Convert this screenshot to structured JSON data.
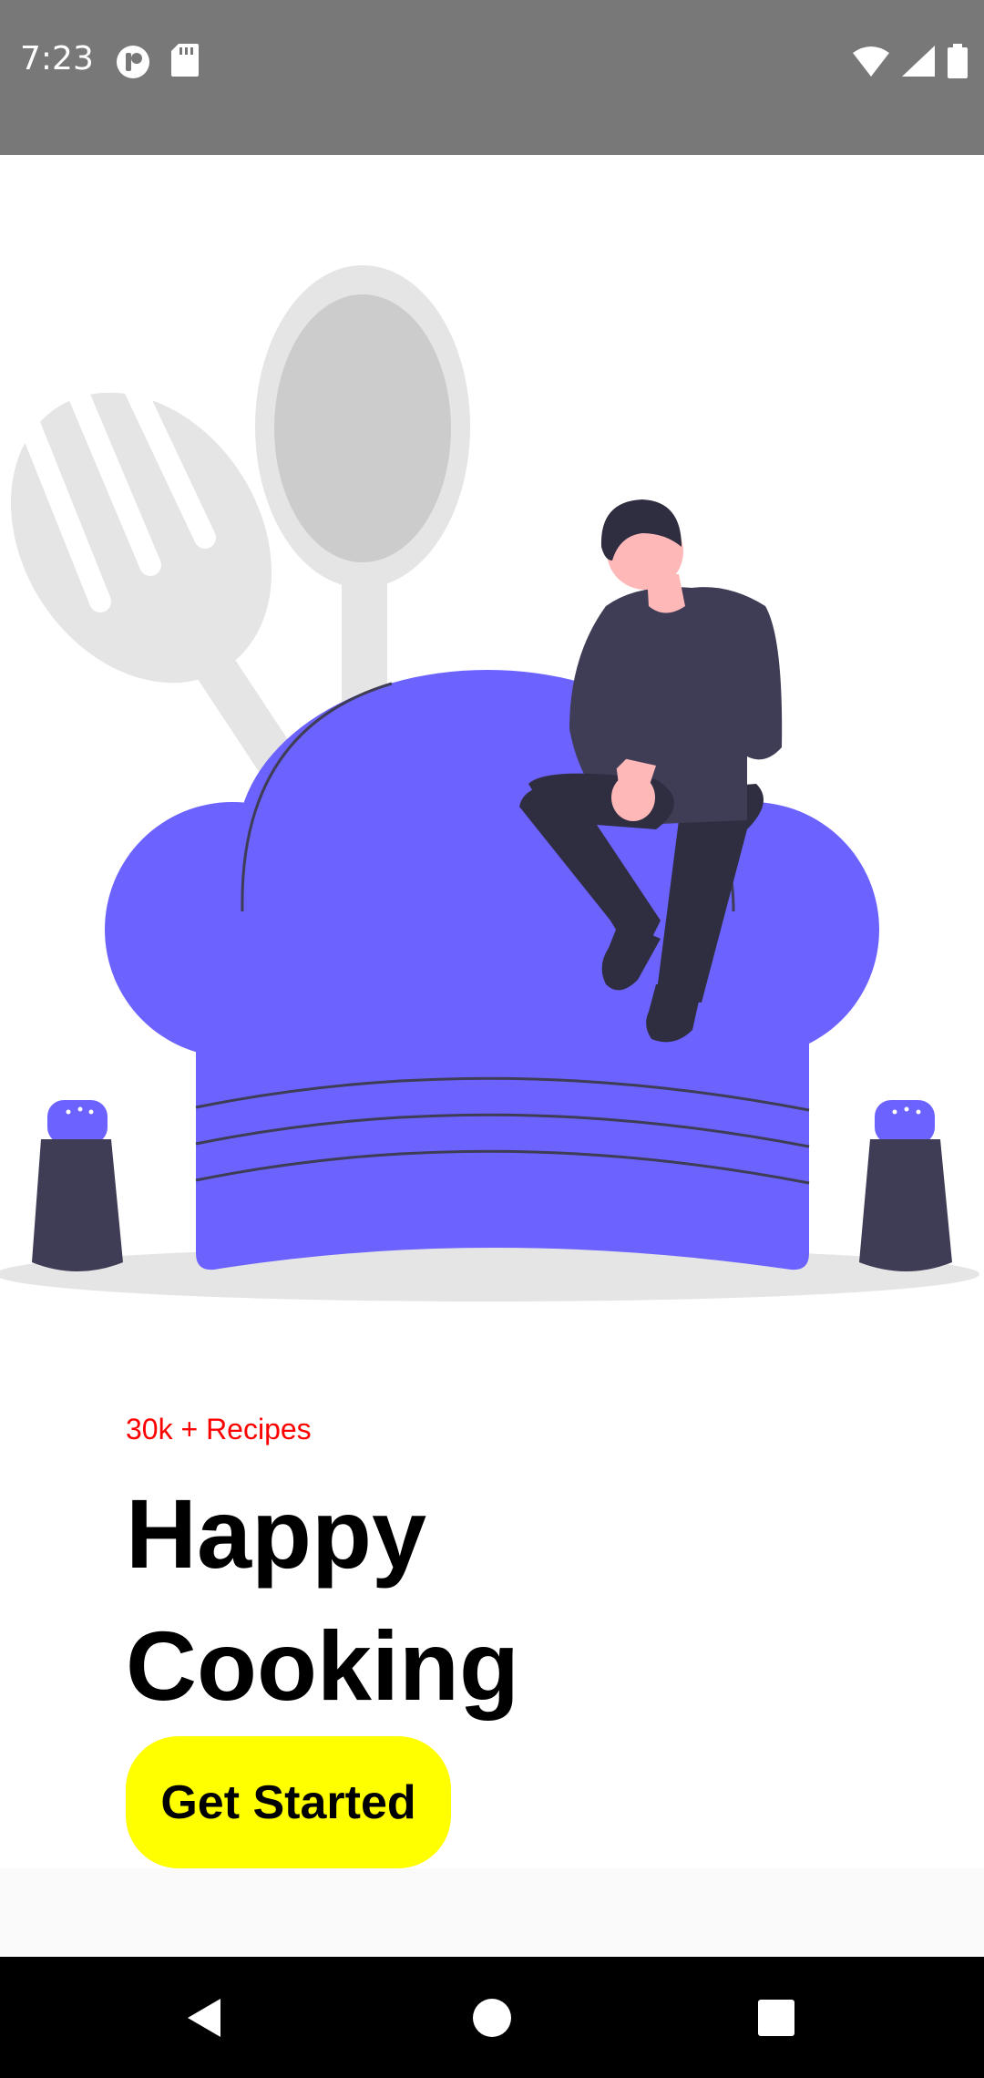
{
  "status_bar": {
    "time": "7:23",
    "left_icons": [
      "app-notification-icon",
      "sd-card-icon"
    ],
    "right_icons": [
      "wifi-icon",
      "cell-signal-icon",
      "battery-icon"
    ],
    "background": "#787878"
  },
  "hero": {
    "illustration": "chef-hat-with-person-sitting-fork-spoon-salt-shakers",
    "hat_color": "#6c63ff",
    "figure_color": "#3f3d56"
  },
  "content": {
    "recipes_count": "30k + Recipes",
    "headline_line1": "Happy",
    "headline_line2": "Cooking",
    "accent_color": "#ff0000"
  },
  "cta": {
    "label": "Get Started",
    "color": "#ffff00"
  },
  "nav_bar": {
    "buttons": [
      "back-icon",
      "home-icon",
      "recents-icon"
    ]
  }
}
